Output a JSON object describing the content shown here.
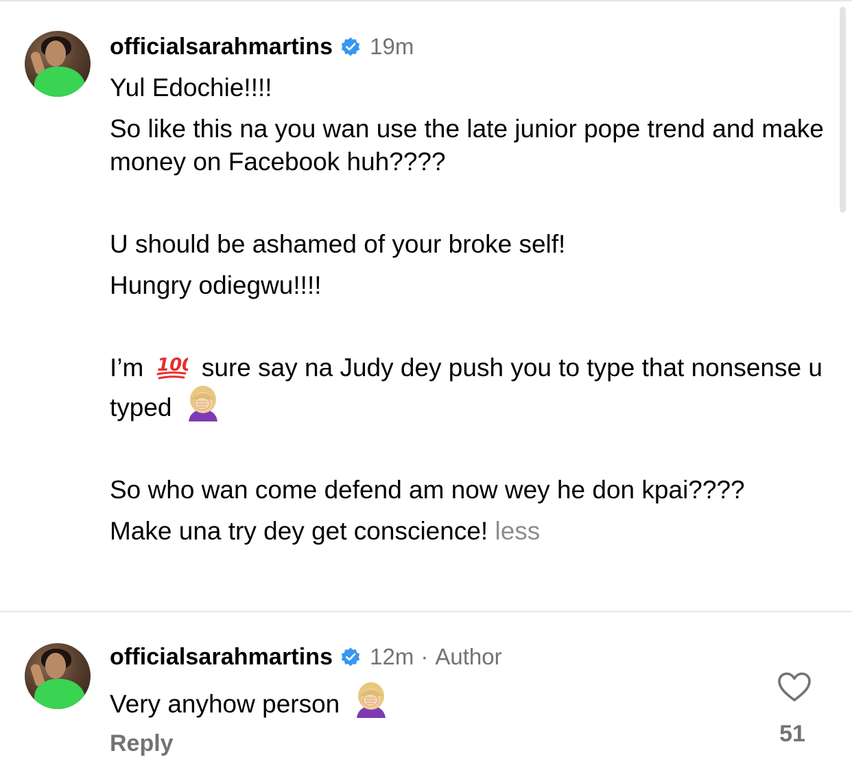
{
  "colors": {
    "text": "#000000",
    "muted": "#737373",
    "verified_blue": "#3897f0",
    "dress_green": "#3ad352",
    "divider": "#e6e6e6"
  },
  "comment1": {
    "username": "officialsarahmartins",
    "time": "19m",
    "line1": "Yul Edochie!!!!",
    "line2": "So like this na you wan use the late junior pope trend and make money on Facebook huh????",
    "line3": "U should be ashamed of your broke self!",
    "line4": "Hungry odiegwu!!!!",
    "line5_before": "I’m",
    "line5_after": "sure say na Judy dey push you to type that nonsense u typed",
    "line6": "So who wan come defend am now wey he don kpai????",
    "line7": "Make una try dey get conscience!",
    "less": "less"
  },
  "comment2": {
    "username": "officialsarahmartins",
    "time": "12m",
    "separator": "·",
    "author": "Author",
    "text": "Very anyhow person",
    "reply": "Reply",
    "likes": "51"
  },
  "icons": {
    "verified": "verified-badge-icon",
    "emoji_100": "hundred-points-emoji",
    "facepalm": "woman-facepalming-emoji",
    "heart": "heart-outline-icon"
  }
}
